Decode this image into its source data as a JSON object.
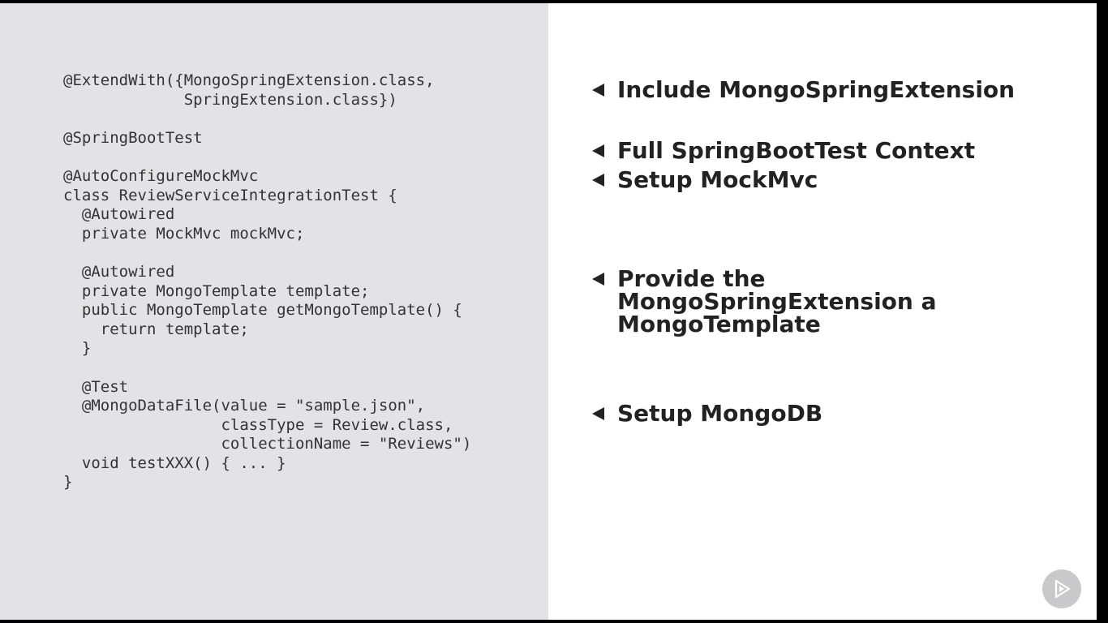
{
  "code": {
    "lines": [
      "@ExtendWith({MongoSpringExtension.class,",
      "             SpringExtension.class})",
      "",
      "@SpringBootTest",
      "",
      "@AutoConfigureMockMvc",
      "class ReviewServiceIntegrationTest {",
      "  @Autowired",
      "  private MockMvc mockMvc;",
      "",
      "  @Autowired",
      "  private MongoTemplate template;",
      "  public MongoTemplate getMongoTemplate() {",
      "    return template;",
      "  }",
      "",
      "  @Test",
      "  @MongoDataFile(value = \"sample.json\",",
      "                 classType = Review.class,",
      "                 collectionName = \"Reviews\")",
      "  void testXXX() { ... }",
      "}"
    ]
  },
  "annotations": [
    {
      "text": "Include MongoSpringExtension",
      "icon": "left-triangle-arrow-icon"
    },
    {
      "text": "Full SpringBootTest Context",
      "icon": "left-triangle-arrow-icon"
    },
    {
      "text": "Setup MockMvc",
      "icon": "left-triangle-arrow-icon"
    },
    {
      "text": "Provide the\nMongoSpringExtension a\nMongoTemplate",
      "icon": "left-triangle-arrow-icon"
    },
    {
      "text": "Setup MongoDB",
      "icon": "left-triangle-arrow-icon"
    }
  ],
  "badge": {
    "icon": "play-logo-icon"
  },
  "colors": {
    "left_background": "#e3e3e5",
    "right_background": "#ffffff",
    "text": "#222222",
    "code_text": "#333333",
    "badge": "#c9c9cb"
  }
}
